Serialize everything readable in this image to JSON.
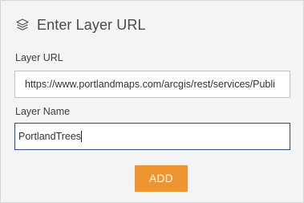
{
  "header": {
    "title": "Enter Layer URL",
    "icon": "layers-icon"
  },
  "form": {
    "url_label": "Layer URL",
    "url_value": "https://www.portlandmaps.com/arcgis/rest/services/Publi",
    "name_label": "Layer Name",
    "name_value": "PortlandTrees"
  },
  "actions": {
    "add_label": "ADD"
  },
  "colors": {
    "panel_bg": "#f4f4f4",
    "accent": "#ee9532",
    "focus_border": "#2a4e76"
  }
}
